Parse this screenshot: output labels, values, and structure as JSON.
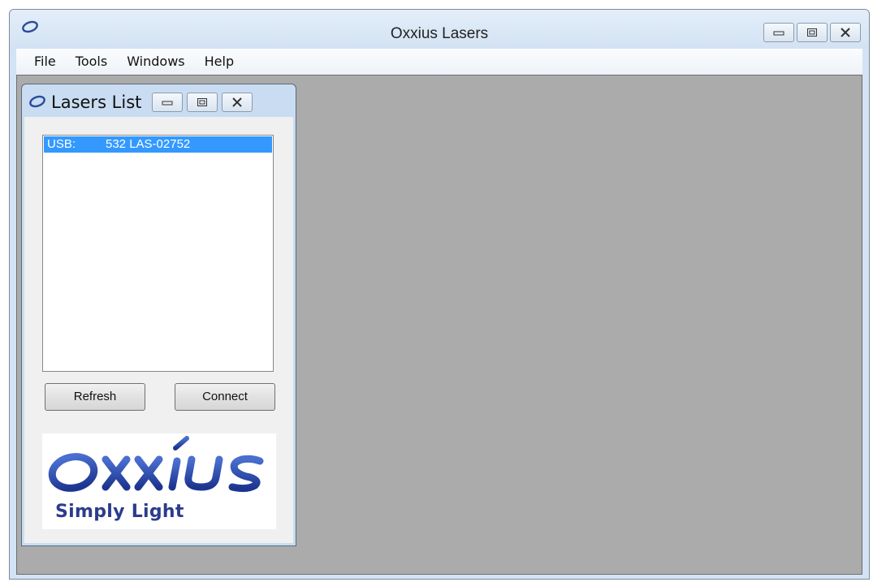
{
  "window": {
    "title": "Oxxius Lasers"
  },
  "menu": {
    "items": [
      "File",
      "Tools",
      "Windows",
      "Help"
    ]
  },
  "lasers_list_window": {
    "title": "Lasers List",
    "list": {
      "items": [
        {
          "port": "USB:",
          "name": "532 LAS-02752",
          "selected": true
        }
      ]
    },
    "buttons": {
      "refresh": "Refresh",
      "connect": "Connect"
    },
    "logo": {
      "wordmark": "OXXIUS",
      "slogan": "Simply Light"
    }
  },
  "icons": {
    "app": "oxxius-ring-icon",
    "minimize": "minimize-icon",
    "restore": "restore-icon",
    "close": "close-icon"
  },
  "colors": {
    "selection": "#3399ff",
    "mdi_background": "#ababab",
    "brand_blue": "#2c3c8c"
  }
}
